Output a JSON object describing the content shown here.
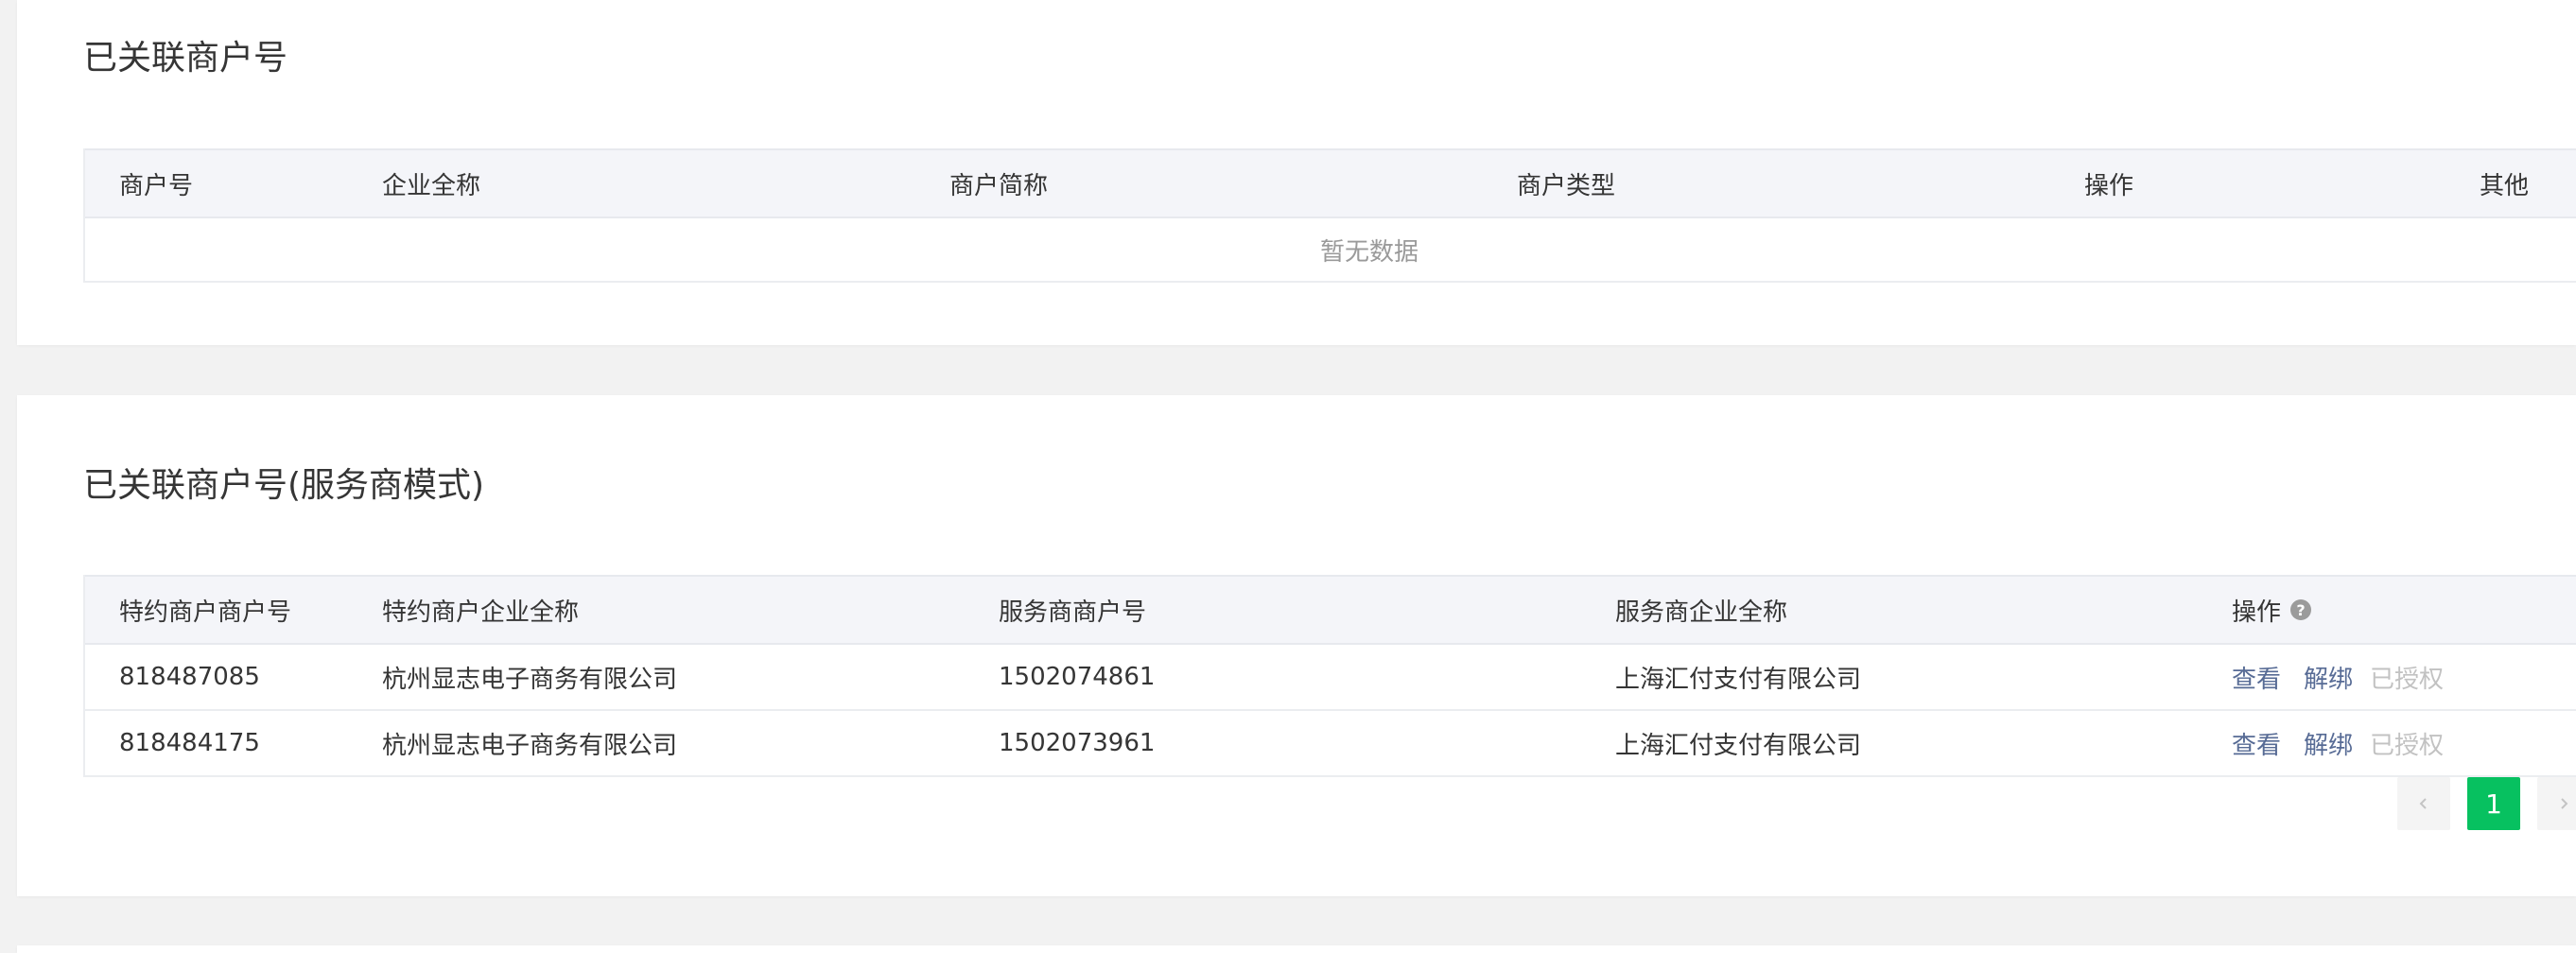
{
  "section1": {
    "title": "已关联商户号",
    "columns": [
      "商户号",
      "企业全称",
      "商户简称",
      "商户类型",
      "操作",
      "其他"
    ],
    "empty_text": "暂无数据"
  },
  "section2": {
    "title": "已关联商户号(服务商模式)",
    "columns": [
      "特约商户商户号",
      "特约商户企业全称",
      "服务商商户号",
      "服务商企业全称",
      "操作"
    ],
    "help_icon": "question-circle-icon",
    "rows": [
      {
        "merchant_id": "818487085",
        "merchant_name": "杭州显志电子商务有限公司",
        "provider_id": "1502074861",
        "provider_name": "上海汇付支付有限公司",
        "action_view": "查看",
        "action_unbind": "解绑",
        "action_authorized": "已授权"
      },
      {
        "merchant_id": "818484175",
        "merchant_name": "杭州显志电子商务有限公司",
        "provider_id": "1502073961",
        "provider_name": "上海汇付支付有限公司",
        "action_view": "查看",
        "action_unbind": "解绑",
        "action_authorized": "已授权"
      }
    ]
  },
  "pagination": {
    "current_page": "1",
    "prev_icon": "chevron-left-icon",
    "next_icon": "chevron-right-icon"
  },
  "colors": {
    "accent": "#07c160",
    "link": "#576b95",
    "disabled": "#c2c2c2"
  }
}
